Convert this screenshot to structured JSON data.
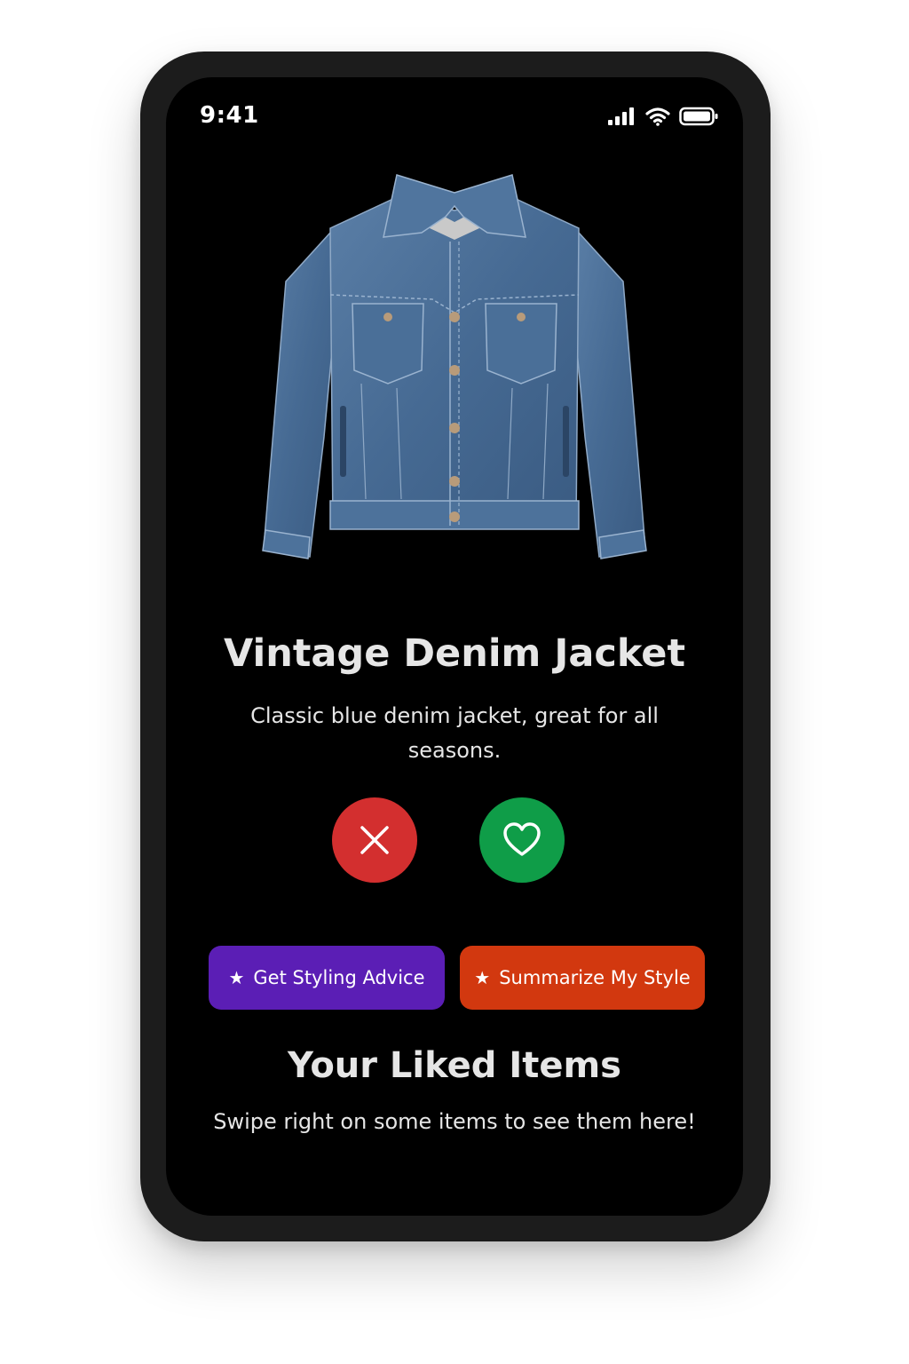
{
  "status_bar": {
    "time": "9:41",
    "icons": [
      "cellular-signal-icon",
      "wifi-icon",
      "battery-icon"
    ]
  },
  "product": {
    "image": "denim-jacket-image",
    "title": "Vintage Denim Jacket",
    "description": "Classic blue denim jacket, great for all seasons."
  },
  "swipe_actions": {
    "dislike_icon": "close-icon",
    "like_icon": "heart-icon"
  },
  "ai_actions": {
    "styling_label": "Get Styling Advice",
    "summarize_label": "Summarize My Style",
    "icon": "star-icon"
  },
  "liked_section": {
    "title": "Your Liked Items",
    "empty_message": "Swipe right on some items to see them here!"
  },
  "colors": {
    "screen_background": "#000000",
    "dislike": "#d32f2f",
    "like": "#0f9d48",
    "styling_button": "#5b1eb5",
    "summarize_button": "#d2380f",
    "text": "#e6e6e6"
  }
}
